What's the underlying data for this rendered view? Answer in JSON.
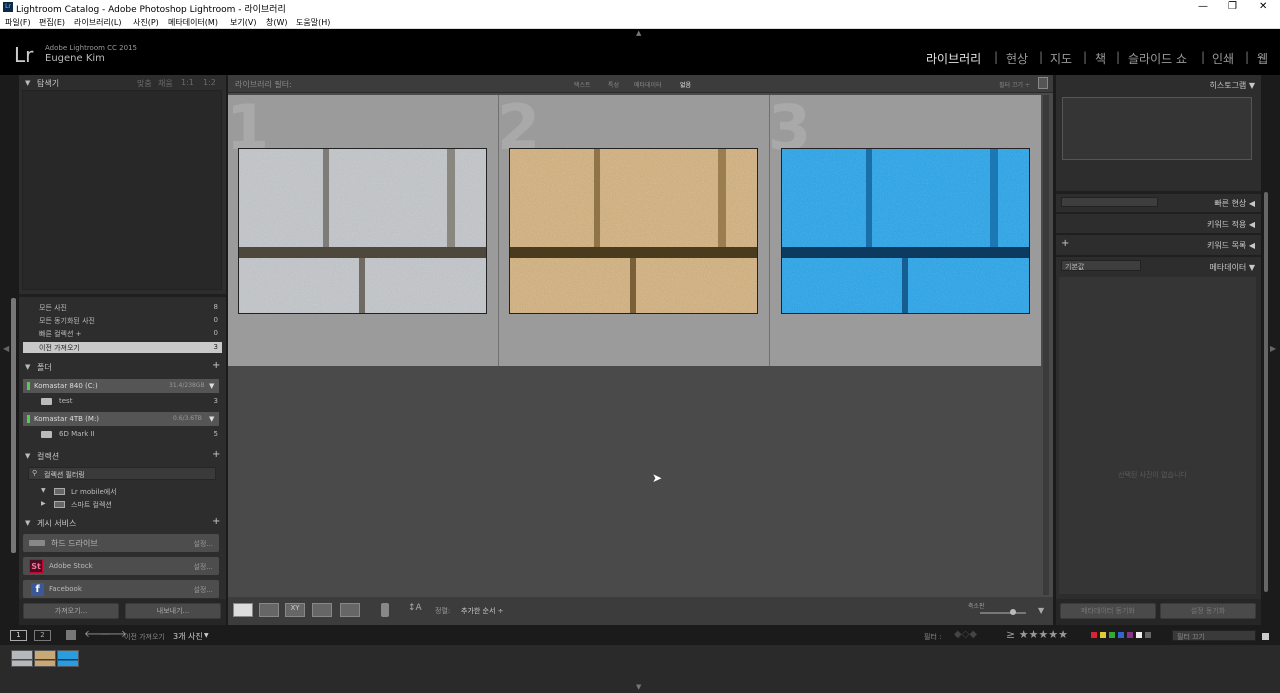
{
  "window": {
    "title": "Lightroom Catalog - Adobe Photoshop Lightroom - 라이브러리",
    "app_icon": "Lr",
    "controls": [
      "—",
      "❐",
      "✕"
    ]
  },
  "menu": [
    "파일(F)",
    "편집(E)",
    "라이브러리(L)",
    "사진(P)",
    "메타데이터(M)",
    "보기(V)",
    "창(W)",
    "도움말(H)"
  ],
  "identity": {
    "logo": "Lr",
    "product": "Adobe Lightroom CC 2015",
    "user": "Eugene Kim"
  },
  "modules": [
    "라이브러리",
    "현상",
    "지도",
    "책",
    "슬라이드 쇼",
    "인쇄",
    "웹"
  ],
  "module_separator": "|",
  "left": {
    "navigator": {
      "title": "탐색기",
      "opts": [
        "맞춤",
        "채움",
        "1:1",
        "1:2"
      ]
    },
    "catalog": [
      {
        "label": "모든 사진",
        "count": "8"
      },
      {
        "label": "모든 동기화된 사진",
        "count": "0"
      },
      {
        "label": "빠른 컬렉션 +",
        "count": "0"
      },
      {
        "label": "이전 가져오기",
        "count": "3"
      }
    ],
    "folders": {
      "title": "폴더",
      "add": "+",
      "volumes": [
        {
          "name": "Komastar 840 (C:)",
          "size": "31.4/238GB"
        },
        {
          "name": "Komastar 4TB (M:)",
          "size": "0.6/3.6TB"
        }
      ],
      "items": [
        {
          "name": "test",
          "count": "3"
        },
        {
          "name": "6D Mark II",
          "count": "5"
        }
      ]
    },
    "collections": {
      "title": "컬렉션",
      "add": "+",
      "filter": "컬렉션 필터링",
      "items": [
        "Lr mobile에서",
        "스마트 컬렉션"
      ]
    },
    "publish": {
      "title": "게시 서비스",
      "add": "+",
      "services": [
        {
          "name": "하드 드라이브",
          "action": "설정..."
        },
        {
          "name": "Adobe Stock",
          "action": "설정...",
          "badge": "St"
        },
        {
          "name": "Facebook",
          "action": "설정...",
          "badge": "f"
        }
      ]
    },
    "import_label": "가져오기...",
    "export_label": "내보내기..."
  },
  "center": {
    "filterbar": {
      "label": "라이브러리 필터:",
      "tabs": [
        "텍스트",
        "특성",
        "메타데이터",
        "없음"
      ],
      "active": "없음",
      "custom": "필터 끄기 ÷"
    },
    "cells": [
      {
        "num": "1",
        "tone": "gray",
        "colors": [
          "#b5b8bc",
          "#9fa3a8"
        ]
      },
      {
        "num": "2",
        "tone": "tan",
        "colors": [
          "#c9a877",
          "#b08f5f"
        ]
      },
      {
        "num": "3",
        "tone": "blue",
        "colors": [
          "#2a9ce0",
          "#1d7fc4"
        ]
      }
    ],
    "toolbar": {
      "sort_label": "정렬:",
      "sort_value": "추가한 순서 ÷",
      "thumb_label": "축소판"
    }
  },
  "right": {
    "histogram": "히스토그램",
    "quick_develop": "빠른 현상",
    "keywording": "키워드 적용",
    "keyword_list": "키워드 목록",
    "keyword_add": "+",
    "metadata": "메타데이터",
    "metadata_preset": "기본값",
    "empty_text": "선택된 사진이 없습니다",
    "sync_metadata": "메타데이터 동기화",
    "sync_settings": "설정 동기화"
  },
  "filmstrip": {
    "page1": "1",
    "page2": "2",
    "source": "이전 가져오기",
    "count": "3개 사진",
    "filter_label": "필터 :",
    "filter_off": "필터 끄기"
  }
}
